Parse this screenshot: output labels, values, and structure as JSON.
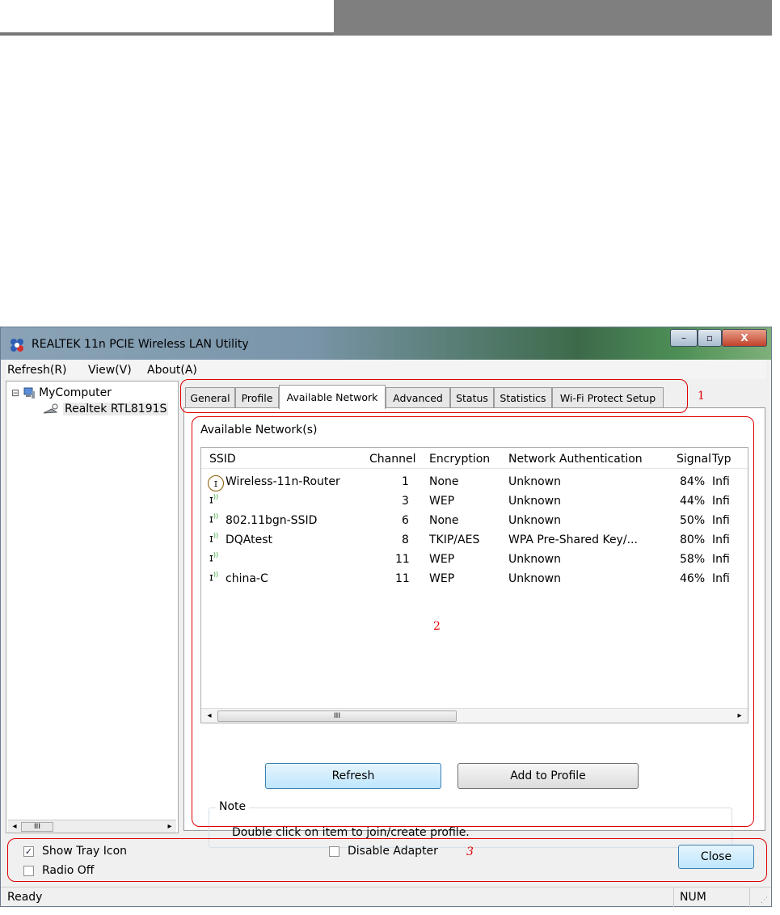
{
  "window": {
    "title": "REALTEK 11n PCIE Wireless LAN Utility",
    "caption_minimize": "–",
    "caption_maximize": "▫",
    "caption_close": "X"
  },
  "menu": [
    "Refresh(R)",
    "View(V)",
    "About(A)"
  ],
  "tree": {
    "root": "MyComputer",
    "child": "Realtek RTL8191S",
    "expand_glyph": "⊟",
    "scroll_glyph": "III"
  },
  "tabs": [
    "General",
    "Profile",
    "Available Network",
    "Advanced",
    "Status",
    "Statistics",
    "Wi-Fi Protect Setup"
  ],
  "active_tab": "Available Network",
  "available": {
    "group_label": "Available Network(s)",
    "columns": [
      "SSID",
      "Channel",
      "Encryption",
      "Network Authentication",
      "Signal",
      "Typ"
    ],
    "rows": [
      {
        "ssid": "Wireless-11n-Router",
        "channel": "1",
        "encryption": "None",
        "auth": "Unknown",
        "signal": "84%",
        "type": "Infi"
      },
      {
        "ssid": "",
        "channel": "3",
        "encryption": "WEP",
        "auth": "Unknown",
        "signal": "44%",
        "type": "Infi"
      },
      {
        "ssid": "802.11bgn-SSID",
        "channel": "6",
        "encryption": "None",
        "auth": "Unknown",
        "signal": "50%",
        "type": "Infi"
      },
      {
        "ssid": "DQAtest",
        "channel": "8",
        "encryption": "TKIP/AES",
        "auth": "WPA Pre-Shared Key/...",
        "signal": "80%",
        "type": "Infi"
      },
      {
        "ssid": "",
        "channel": "11",
        "encryption": "WEP",
        "auth": "Unknown",
        "signal": "58%",
        "type": "Infi"
      },
      {
        "ssid": "china-C",
        "channel": "11",
        "encryption": "WEP",
        "auth": "Unknown",
        "signal": "46%",
        "type": "Infi"
      }
    ],
    "scroll_glyph": "III",
    "refresh_button": "Refresh",
    "add_profile_button": "Add to Profile",
    "note_label": "Note",
    "note_text": "Double click on item to join/create profile."
  },
  "bottom": {
    "show_tray_icon": {
      "label": "Show Tray Icon",
      "checked": true
    },
    "radio_off": {
      "label": "Radio Off",
      "checked": false
    },
    "disable_adapter": {
      "label": "Disable Adapter",
      "checked": false
    },
    "close_button": "Close"
  },
  "status": {
    "left": "Ready",
    "right": "NUM"
  },
  "annotations": [
    "1",
    "2",
    "3"
  ],
  "colors": {
    "annotation_red": "#e00000",
    "primary_button": "#bee6fd"
  }
}
